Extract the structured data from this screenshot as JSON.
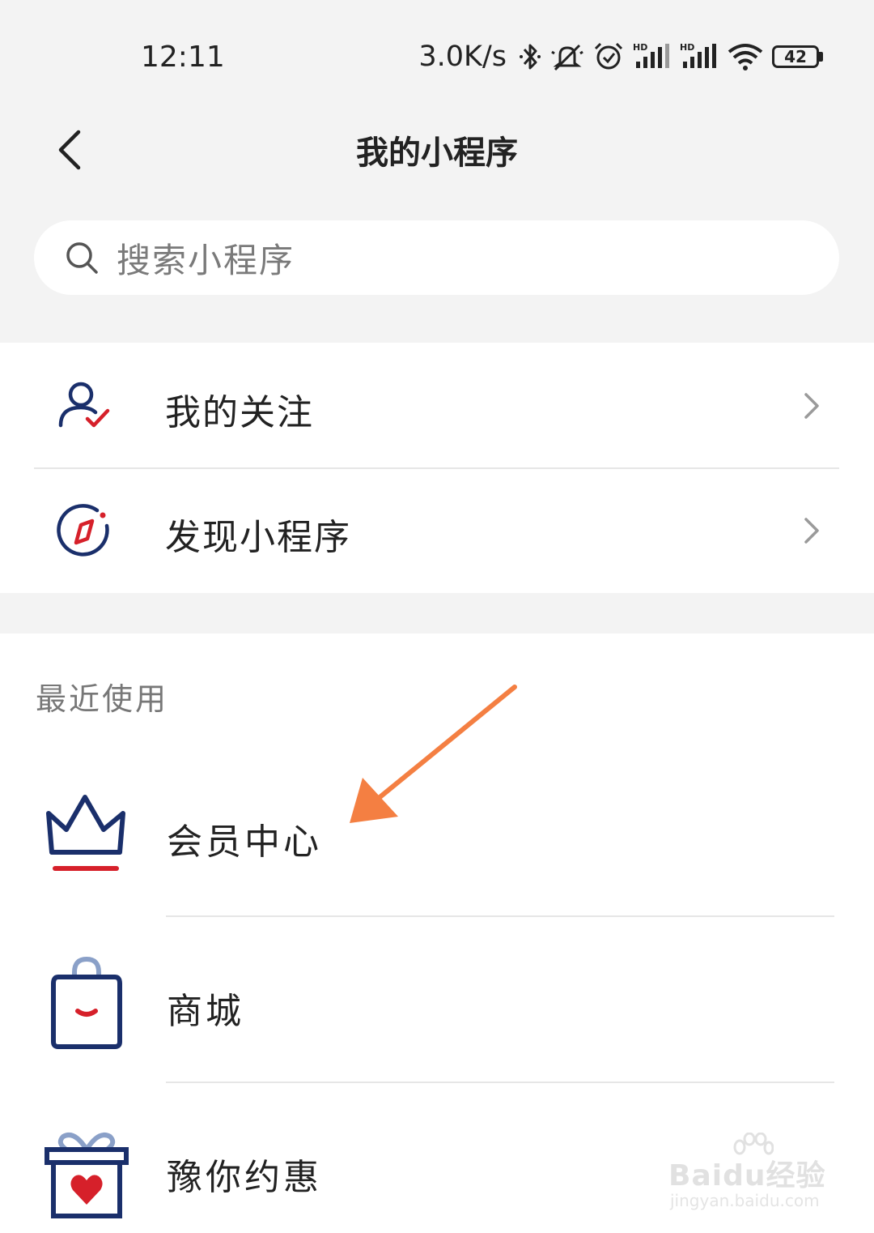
{
  "status_bar": {
    "time": "12:11",
    "net_speed": "3.0K/s",
    "battery": "42",
    "icons": [
      "bluetooth-icon",
      "mute-icon",
      "alarm-icon",
      "hd-signal-icon",
      "hd-signal-icon",
      "wifi-icon",
      "battery-icon"
    ]
  },
  "header": {
    "title": "我的小程序",
    "back_icon": "chevron-left-icon"
  },
  "search": {
    "placeholder": "搜索小程序",
    "icon": "search-icon"
  },
  "menu": [
    {
      "label": "我的关注",
      "icon": "user-check-icon"
    },
    {
      "label": "发现小程序",
      "icon": "compass-icon"
    }
  ],
  "recent": {
    "title": "最近使用",
    "items": [
      {
        "label": "会员中心",
        "icon": "crown-icon"
      },
      {
        "label": "商城",
        "icon": "shopping-bag-icon"
      },
      {
        "label": "豫你约惠",
        "icon": "gift-box-icon"
      }
    ]
  },
  "colors": {
    "navy": "#1a2f6b",
    "red": "#d6202a",
    "arrow": "#f47f42",
    "background": "#f3f3f3"
  },
  "watermark": {
    "brand": "Baidu经验",
    "url": "jingyan.baidu.com"
  }
}
